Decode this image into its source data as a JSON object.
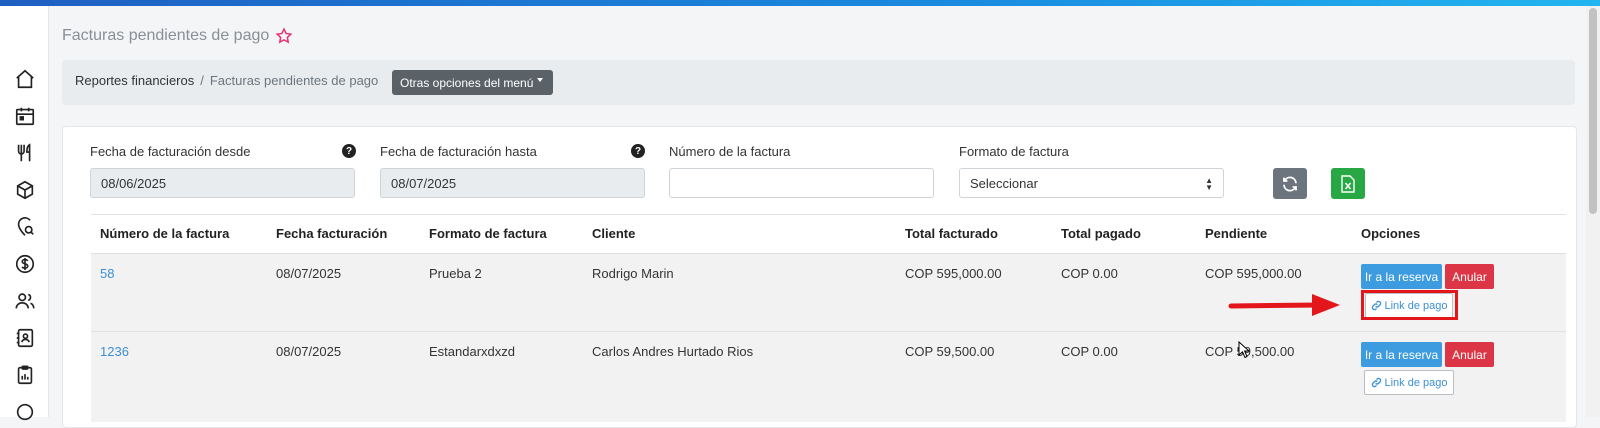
{
  "page": {
    "title": "Facturas pendientes de pago"
  },
  "breadcrumb": {
    "parent": "Reportes financieros",
    "separator": "/",
    "current": "Facturas pendientes de pago",
    "menu_button": "Otras opciones del menú"
  },
  "sidebar": {
    "icons": [
      "home-icon",
      "calendar-icon",
      "restaurant-icon",
      "package-icon",
      "location-search-icon",
      "dollar-icon",
      "users-icon",
      "contacts-icon",
      "clipboard-icon",
      "circle-icon"
    ]
  },
  "filters": {
    "date_from": {
      "label": "Fecha de facturación desde",
      "value": "08/06/2025",
      "help": "?"
    },
    "date_to": {
      "label": "Fecha de facturación hasta",
      "value": "08/07/2025",
      "help": "?"
    },
    "invoice_number": {
      "label": "Número de la factura",
      "value": ""
    },
    "invoice_format": {
      "label": "Formato de factura",
      "value": "Seleccionar"
    }
  },
  "table": {
    "headers": [
      "Número de la factura",
      "Fecha facturación",
      "Formato de factura",
      "Cliente",
      "Total facturado",
      "Total pagado",
      "Pendiente",
      "Opciones"
    ],
    "rows": [
      {
        "number": "58",
        "date": "08/07/2025",
        "format": "Prueba 2",
        "client": "Rodrigo Marin",
        "total": "COP 595,000.00",
        "paid": "COP 0.00",
        "pending": "COP 595,000.00"
      },
      {
        "number": "1236",
        "date": "08/07/2025",
        "format": "Estandarxdxzd",
        "client": "Carlos Andres Hurtado Rios",
        "total": "COP 59,500.00",
        "paid": "COP 0.00",
        "pending": "COP 59,500.00"
      }
    ],
    "actions": {
      "go": "Ir a la reserva",
      "cancel": "Anular",
      "pay_link": "Link de pago"
    }
  },
  "colors": {
    "primary_blue": "#3d9ce0",
    "danger_red": "#dc3545",
    "success_green": "#28a745",
    "annotation_red": "#e3161b",
    "star_pink": "#e8336e"
  }
}
